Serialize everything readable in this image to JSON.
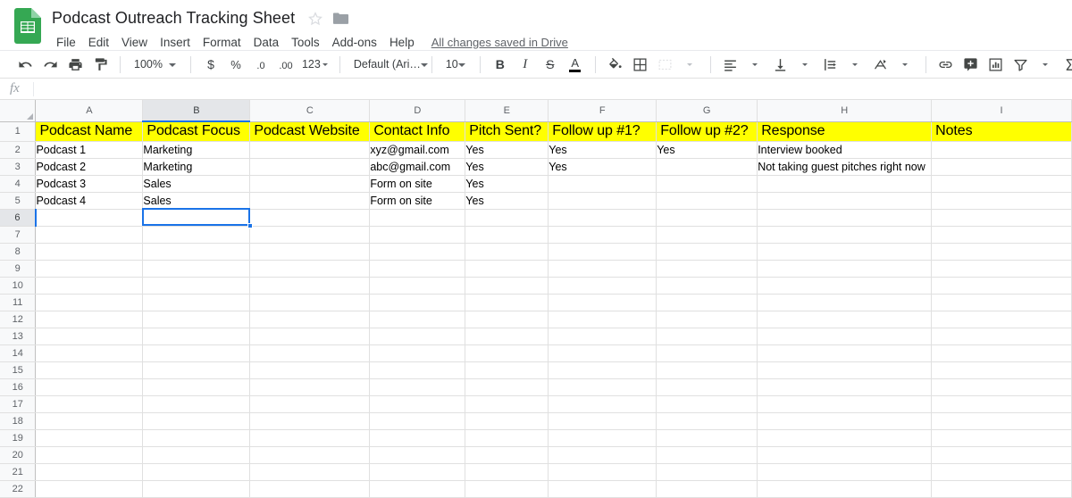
{
  "app": {
    "logo_icon": "sheets-logo-icon",
    "doc_title": "Podcast Outreach Tracking Sheet",
    "star_icon": "star-outline-icon",
    "folder_icon": "folder-icon",
    "save_status": "All changes saved in Drive"
  },
  "menubar": {
    "items": [
      {
        "label": "File"
      },
      {
        "label": "Edit"
      },
      {
        "label": "View"
      },
      {
        "label": "Insert"
      },
      {
        "label": "Format"
      },
      {
        "label": "Data"
      },
      {
        "label": "Tools"
      },
      {
        "label": "Add-ons"
      },
      {
        "label": "Help"
      }
    ]
  },
  "toolbar": {
    "undo_icon": "undo-icon",
    "redo_icon": "redo-icon",
    "print_icon": "print-icon",
    "paint_format_icon": "paint-format-icon",
    "zoom_value": "100%",
    "currency_label": "$",
    "percent_label": "%",
    "decrease_decimal_label": ".0",
    "increase_decimal_label": ".00",
    "more_formats_label": "123",
    "font_value": "Default (Ari…",
    "font_size_value": "10",
    "bold_label": "B",
    "italic_label": "I",
    "strikethrough_label": "S",
    "text_color_label": "A",
    "fill_color_icon": "fill-color-icon",
    "borders_icon": "borders-icon",
    "merge_cells_icon": "merge-cells-icon",
    "horizontal_align_icon": "horizontal-align-icon",
    "vertical_align_icon": "vertical-align-icon",
    "text_wrap_icon": "text-wrap-icon",
    "text_rotation_icon": "text-rotation-icon",
    "insert_link_icon": "insert-link-icon",
    "insert_comment_icon": "insert-comment-icon",
    "insert_chart_icon": "insert-chart-icon",
    "filter_icon": "filter-icon",
    "functions_icon": "sigma-functions-icon"
  },
  "formula_bar": {
    "fx_label": "fx",
    "value": "",
    "placeholder": ""
  },
  "spreadsheet": {
    "selected_cell": "B6",
    "header_fill_color": "#ffff00",
    "selection_color": "#1a73e8",
    "column_letters": [
      "A",
      "B",
      "C",
      "D",
      "E",
      "F",
      "G",
      "H",
      "I"
    ],
    "row_numbers": [
      1,
      2,
      3,
      4,
      5,
      6,
      7,
      8,
      9,
      10,
      11,
      12,
      13,
      14,
      15,
      16,
      17,
      18,
      19,
      20,
      21,
      22
    ],
    "headers": [
      "Podcast Name",
      "Podcast Focus",
      "Podcast Website",
      "Contact Info",
      "Pitch Sent?",
      "Follow up #1?",
      "Follow up #2?",
      "Response",
      "Notes"
    ],
    "rows": [
      {
        "row": 2,
        "cells": [
          "Podcast 1",
          "Marketing",
          "",
          "xyz@gmail.com",
          "Yes",
          "Yes",
          "Yes",
          "Interview booked",
          ""
        ]
      },
      {
        "row": 3,
        "cells": [
          "Podcast 2",
          "Marketing",
          "",
          "abc@gmail.com",
          "Yes",
          "Yes",
          "",
          "Not taking guest pitches right now",
          ""
        ]
      },
      {
        "row": 4,
        "cells": [
          "Podcast 3",
          "Sales",
          "",
          "Form on site",
          "Yes",
          "",
          "",
          "",
          ""
        ]
      },
      {
        "row": 5,
        "cells": [
          "Podcast 4",
          "Sales",
          "",
          "Form on site",
          "Yes",
          "",
          "",
          "",
          ""
        ]
      }
    ],
    "empty_row_count": 17
  }
}
